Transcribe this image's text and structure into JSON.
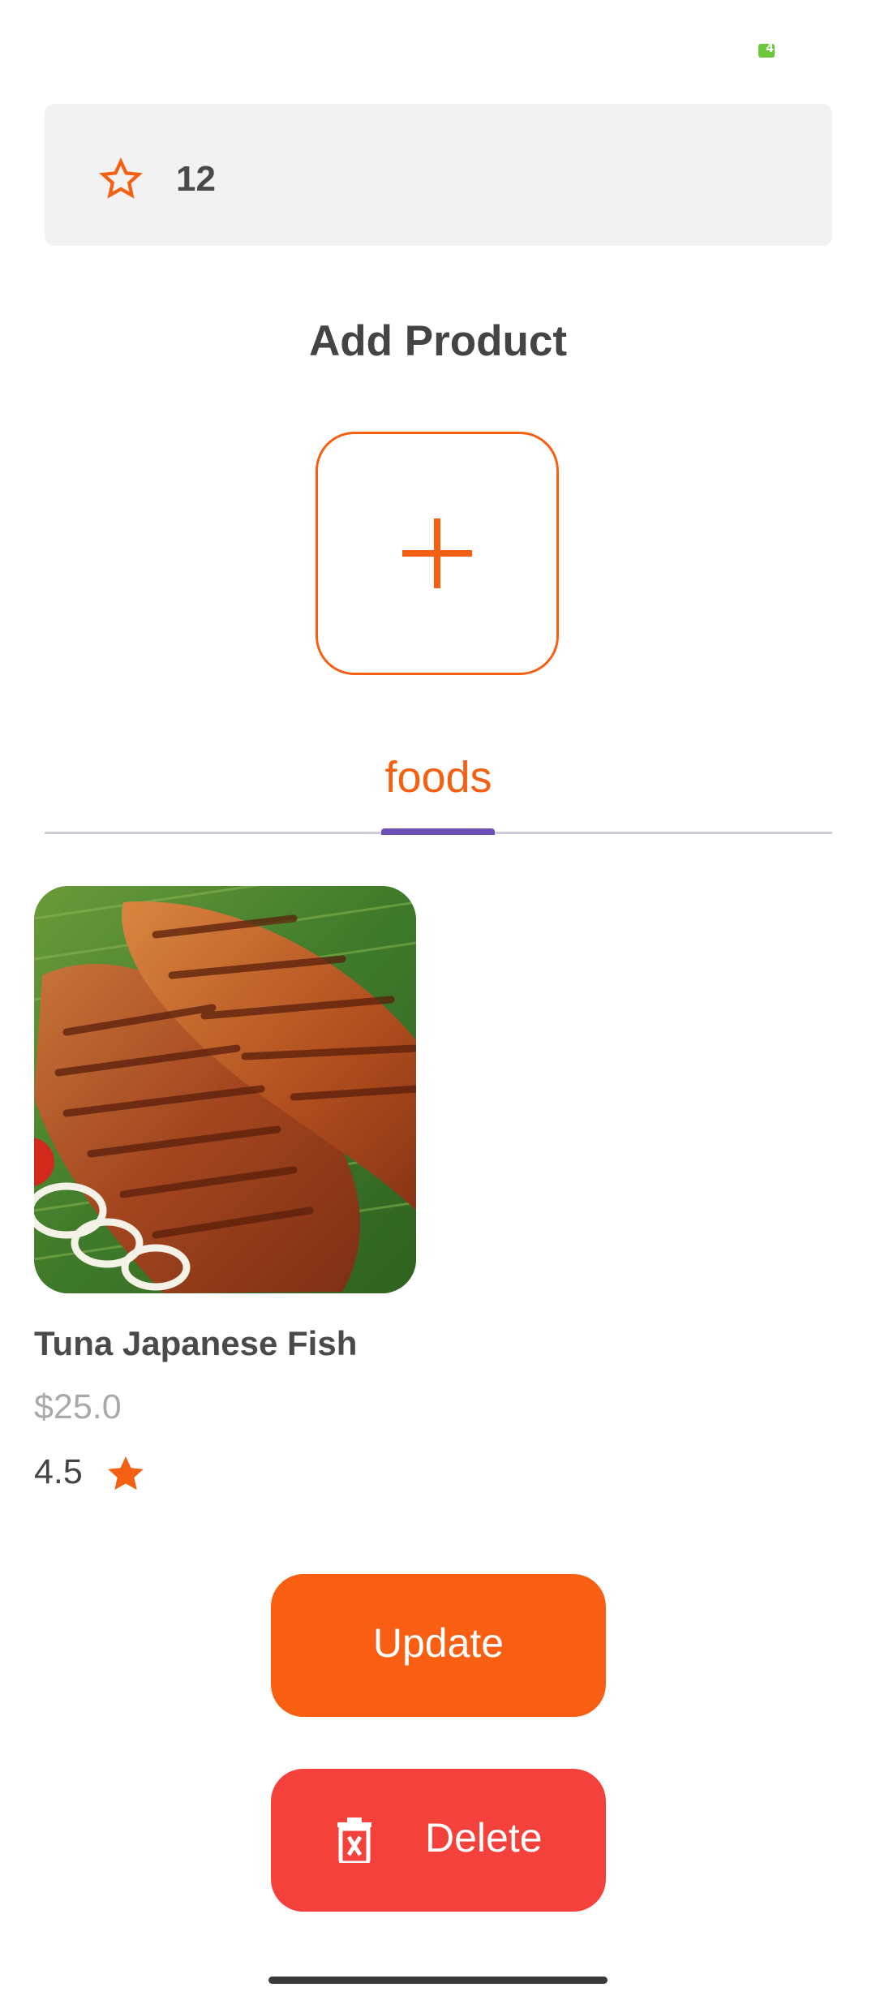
{
  "status_bar": {
    "battery_text": "4",
    "battery_color": "#6cc83a"
  },
  "rating_card": {
    "icon": "star-outline-icon",
    "count": "12"
  },
  "title": "Add Product",
  "add_button": {
    "icon": "plus-icon"
  },
  "tabs": [
    {
      "label": "foods",
      "selected": true
    }
  ],
  "product": {
    "name": "Tuna Japanese Fish",
    "price": "$25.0",
    "rating": "4.5",
    "image": "fried-fish-photo"
  },
  "actions": {
    "update_label": "Update",
    "delete_label": "Delete",
    "delete_icon": "trash-icon"
  },
  "colors": {
    "accent": "#f55f12",
    "update_button": "#f95f12",
    "delete_button": "#f4413b",
    "tab_indicator": "#6a4fb5",
    "card_background": "#f2f2f2"
  }
}
